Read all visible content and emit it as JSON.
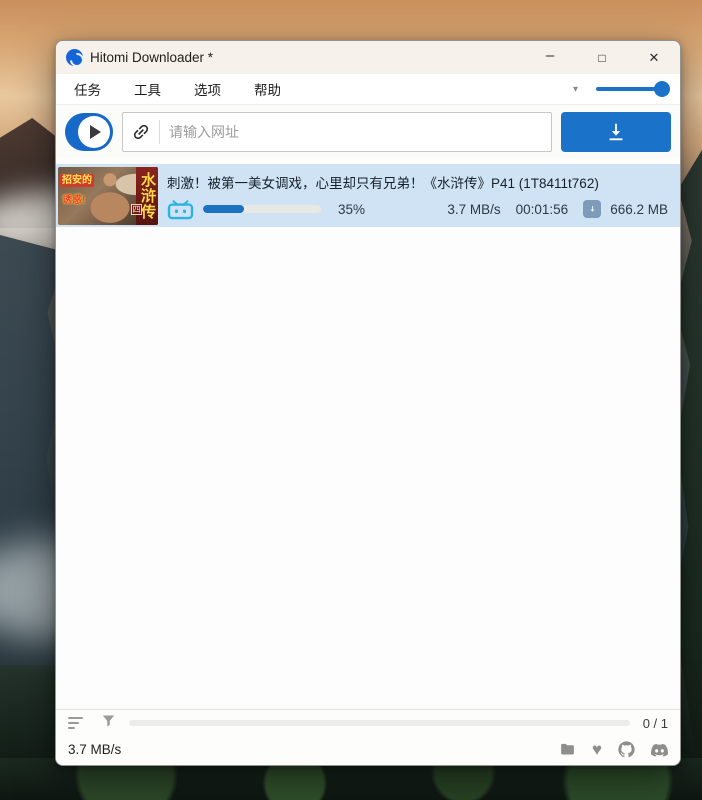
{
  "window": {
    "title": "Hitomi Downloader *",
    "minimize_label": "–",
    "maximize_label": "□",
    "close_label": "✕"
  },
  "menu": {
    "items": [
      "任务",
      "工具",
      "选项",
      "帮助"
    ],
    "caret": "▾"
  },
  "toolbar": {
    "url_placeholder": "请输入网址",
    "url_value": ""
  },
  "download_item": {
    "title": "刺激！被第一美女调戏，心里却只有兄弟！《水浒传》P41 (1T8411t762)",
    "percent_label": "35%",
    "progress_style": "width:35%",
    "speed": "3.7 MB/s",
    "elapsed": "00:01:56",
    "size": "666.2 MB",
    "thumbnail": {
      "tag_line1": "招安的",
      "tag_line2": "诱惑!",
      "vertical_title": "水浒传",
      "badge": "四"
    }
  },
  "status_bar": {
    "counter": "0 / 1"
  },
  "footer": {
    "total_speed": "3.7 MB/s"
  },
  "icons": {
    "app": "hitomi-app-icon",
    "toolbar": [
      "play-toggle-icon",
      "link-icon",
      "download-icon"
    ],
    "row": [
      "bilibili-icon",
      "size-download-badge-icon"
    ],
    "status": [
      "sort-icon",
      "filter-icon"
    ],
    "footer": [
      "folder-icon",
      "heart-icon",
      "github-icon",
      "discord-icon"
    ]
  },
  "colors": {
    "accent_blue": "#1a73c9",
    "selected_row": "#cfe3f4",
    "bilibili_blue": "#2ab3e4",
    "progress_fill": "#1b72c0",
    "titlebar_bg": "#f6f1ea"
  }
}
